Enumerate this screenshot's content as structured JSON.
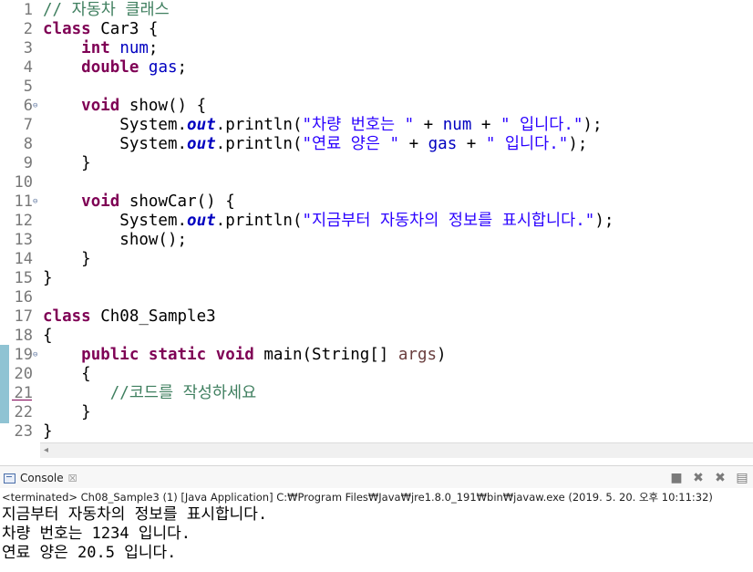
{
  "editor": {
    "line_numbers": [
      "1",
      "2",
      "3",
      "4",
      "5",
      "6",
      "7",
      "8",
      "9",
      "10",
      "11",
      "12",
      "13",
      "14",
      "15",
      "16",
      "17",
      "18",
      "19",
      "20",
      "21",
      "22",
      "23"
    ],
    "lines": {
      "l1": [
        {
          "t": "// 자동차 클래스",
          "c": "cm"
        }
      ],
      "l2": [
        {
          "t": "class",
          "c": "kw"
        },
        {
          "t": " Car3 {",
          "c": ""
        }
      ],
      "l3": [
        {
          "t": "    ",
          "c": ""
        },
        {
          "t": "int",
          "c": "kw"
        },
        {
          "t": " ",
          "c": ""
        },
        {
          "t": "num",
          "c": "fld-plain"
        },
        {
          "t": ";",
          "c": ""
        }
      ],
      "l4": [
        {
          "t": "    ",
          "c": ""
        },
        {
          "t": "double",
          "c": "kw"
        },
        {
          "t": " ",
          "c": ""
        },
        {
          "t": "gas",
          "c": "fld-plain"
        },
        {
          "t": ";",
          "c": ""
        }
      ],
      "l5": [],
      "l6": [
        {
          "t": "    ",
          "c": ""
        },
        {
          "t": "void",
          "c": "kw"
        },
        {
          "t": " show() {",
          "c": ""
        }
      ],
      "l7": [
        {
          "t": "        System.",
          "c": ""
        },
        {
          "t": "out",
          "c": "fld"
        },
        {
          "t": ".println(",
          "c": ""
        },
        {
          "t": "\"차량 번호는 \"",
          "c": "str"
        },
        {
          "t": " + ",
          "c": ""
        },
        {
          "t": "num",
          "c": "fld-plain"
        },
        {
          "t": " + ",
          "c": ""
        },
        {
          "t": "\" 입니다.\"",
          "c": "str"
        },
        {
          "t": ");",
          "c": ""
        }
      ],
      "l8": [
        {
          "t": "        System.",
          "c": ""
        },
        {
          "t": "out",
          "c": "fld"
        },
        {
          "t": ".println(",
          "c": ""
        },
        {
          "t": "\"연료 양은 \"",
          "c": "str"
        },
        {
          "t": " + ",
          "c": ""
        },
        {
          "t": "gas",
          "c": "fld-plain"
        },
        {
          "t": " + ",
          "c": ""
        },
        {
          "t": "\" 입니다.\"",
          "c": "str"
        },
        {
          "t": ");",
          "c": ""
        }
      ],
      "l9": [
        {
          "t": "    }",
          "c": ""
        }
      ],
      "l10": [],
      "l11": [
        {
          "t": "    ",
          "c": ""
        },
        {
          "t": "void",
          "c": "kw"
        },
        {
          "t": " showCar() {",
          "c": ""
        }
      ],
      "l12": [
        {
          "t": "        System.",
          "c": ""
        },
        {
          "t": "out",
          "c": "fld"
        },
        {
          "t": ".println(",
          "c": ""
        },
        {
          "t": "\"지금부터 자동차의 정보를 표시합니다.\"",
          "c": "str"
        },
        {
          "t": ");",
          "c": ""
        }
      ],
      "l13": [
        {
          "t": "        show();",
          "c": ""
        }
      ],
      "l14": [
        {
          "t": "    }",
          "c": ""
        }
      ],
      "l15": [
        {
          "t": "}",
          "c": ""
        }
      ],
      "l16": [],
      "l17": [
        {
          "t": "class",
          "c": "kw"
        },
        {
          "t": " Ch08_Sample3",
          "c": ""
        }
      ],
      "l18": [
        {
          "t": "{",
          "c": ""
        }
      ],
      "l19": [
        {
          "t": "    ",
          "c": ""
        },
        {
          "t": "public",
          "c": "kw"
        },
        {
          "t": " ",
          "c": ""
        },
        {
          "t": "static",
          "c": "kw"
        },
        {
          "t": " ",
          "c": ""
        },
        {
          "t": "void",
          "c": "kw"
        },
        {
          "t": " main(String[] ",
          "c": ""
        },
        {
          "t": "args",
          "c": "var"
        },
        {
          "t": ")",
          "c": ""
        }
      ],
      "l20": [
        {
          "t": "    {",
          "c": ""
        }
      ],
      "l21": [
        {
          "t": "       ",
          "c": ""
        },
        {
          "t": "//코드를 작성하세요",
          "c": "cm"
        }
      ],
      "l22": [
        {
          "t": "    }",
          "c": ""
        }
      ],
      "l23": [
        {
          "t": "}",
          "c": ""
        }
      ]
    }
  },
  "console": {
    "tab_label": "Console",
    "tab_close": "☒",
    "status": "<terminated> Ch08_Sample3 (1) [Java Application] C:₩Program Files₩Java₩jre1.8.0_191₩bin₩javaw.exe (2019. 5. 20. 오후 10:11:32)",
    "output": [
      "지금부터 자동차의 정보를 표시합니다.",
      "차량 번호는 1234 입니다.",
      "연료 양은 20.5 입니다."
    ]
  },
  "icons": {
    "fold": "⊖",
    "scroll_left": "◂",
    "terminate": "■",
    "remove_launch": "✖",
    "remove_all": "✖",
    "scroll_lock": "▤"
  },
  "colors": {
    "keyword": "#7f0055",
    "comment": "#3f7f5f",
    "string": "#2a00ff",
    "field": "#0000c0",
    "line_number": "#787878",
    "range_marker": "#8fc3d3"
  }
}
